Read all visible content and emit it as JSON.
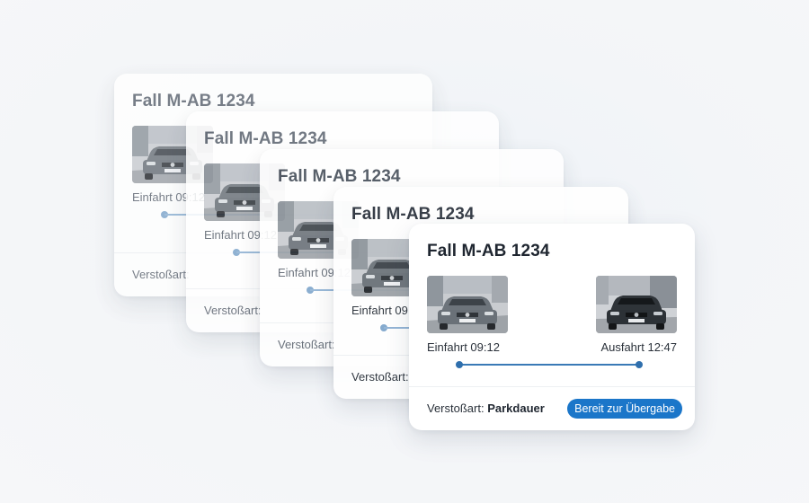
{
  "case": {
    "title": "Fall M-AB 1234",
    "entry_label": "Einfahrt 09:12",
    "exit_label": "Ausfahrt 12:47",
    "violation_prefix": "Verstoßart:",
    "violation_value": "Parkdauer",
    "status_badge": "Bereit zur Übergabe"
  },
  "cards_behind": [
    {
      "title": "Fall M-AB 1234",
      "entry_label": "Einfahrt 09:12",
      "violation_prefix": "Verstoßart:"
    },
    {
      "title": "Fall M-AB 1234",
      "entry_label": "Einfahrt 09:12",
      "violation_prefix": "Verstoßart:"
    },
    {
      "title": "Fall M-AB 1234",
      "entry_label": "Einfahrt 09:12",
      "violation_prefix": "Verstoßart:"
    },
    {
      "title": "Fall M-AB 1234",
      "entry_label": "Einfahrt 09:12",
      "violation_prefix": "Verstoßart:"
    }
  ],
  "icons": {
    "entry_photo": "car-photo-entry",
    "exit_photo": "car-photo-exit"
  },
  "colors": {
    "accent": "#1b76c9",
    "timeline": "#3a7ab6",
    "background": "#f3f5f8"
  }
}
